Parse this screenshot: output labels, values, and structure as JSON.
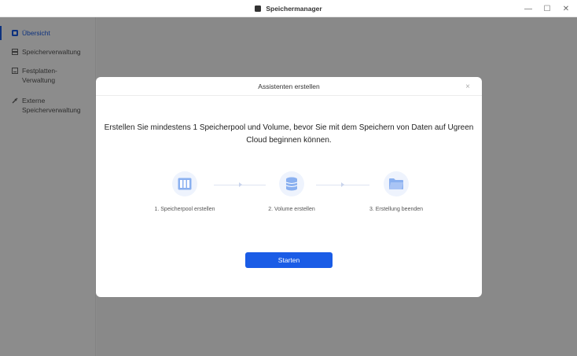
{
  "window": {
    "title": "Speichermanager",
    "minimize": "—",
    "maximize": "☐",
    "close": "✕"
  },
  "sidebar": {
    "items": [
      {
        "label": "Übersicht",
        "active": true
      },
      {
        "label": "Speicherverwaltung",
        "active": false
      },
      {
        "label": "Festplatten-Verwaltung",
        "active": false
      },
      {
        "label": "Externe Speicherverwaltung",
        "active": false
      }
    ]
  },
  "dialog": {
    "title": "Assistenten erstellen",
    "close": "×",
    "message": "Erstellen Sie mindestens 1 Speicherpool und Volume, bevor Sie mit dem Speichern von Daten auf Ugreen Cloud beginnen können.",
    "steps": [
      {
        "label": "1. Speicherpool erstellen",
        "icon": "storage-pool-icon"
      },
      {
        "label": "2. Volume erstellen",
        "icon": "volume-icon"
      },
      {
        "label": "3. Erstellung beenden",
        "icon": "folder-icon"
      }
    ],
    "start_label": "Starten"
  },
  "colors": {
    "accent": "#1a5ce6",
    "step_bg": "#eef3fd",
    "icon": "#8ab0f0"
  }
}
